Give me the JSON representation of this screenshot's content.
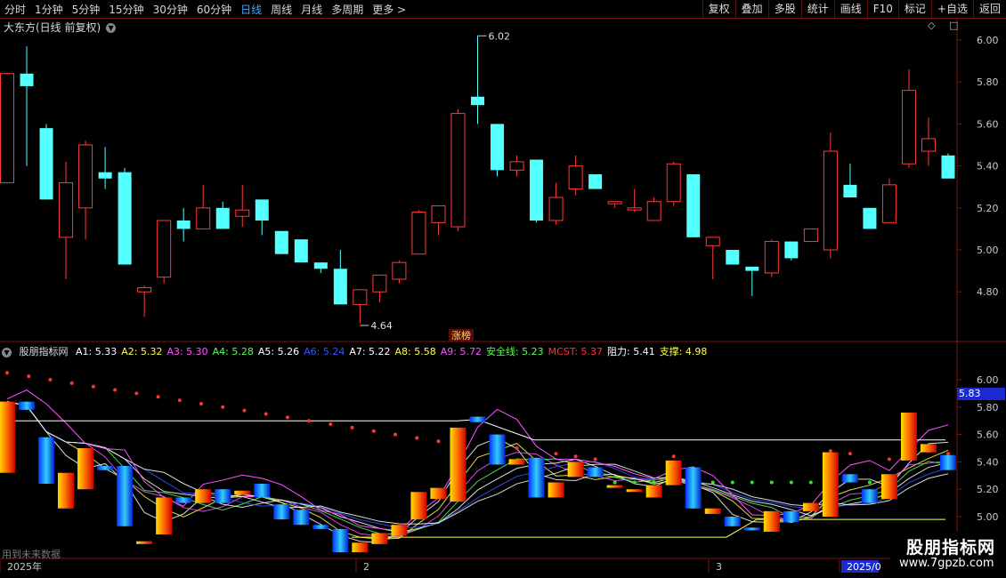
{
  "toolbar": {
    "tabs": [
      "分时",
      "1分钟",
      "5分钟",
      "15分钟",
      "30分钟",
      "60分钟",
      "日线",
      "周线",
      "月线",
      "多周期",
      "更多 >"
    ],
    "active_tab": 6,
    "right_buttons": [
      "复权",
      "叠加",
      "多股",
      "统计",
      "画线",
      "F10",
      "标记",
      "+自选",
      "返回"
    ]
  },
  "main": {
    "title": "大东方(日线 前复权)",
    "high_label": "6.02",
    "low_label": "4.64",
    "tag": "涨榜",
    "y_ticks": [
      "6.00",
      "5.80",
      "5.60",
      "5.40",
      "5.20",
      "5.00",
      "4.80"
    ],
    "icons": [
      "diamond-icon",
      "square-icon"
    ]
  },
  "indicator": {
    "name": "股朋指标网",
    "values": [
      {
        "label": "A1: 5.33",
        "color": "#ffffff"
      },
      {
        "label": "A2: 5.32",
        "color": "#ffff55"
      },
      {
        "label": "A3: 5.30",
        "color": "#ff55ff"
      },
      {
        "label": "A4: 5.28",
        "color": "#55ff55"
      },
      {
        "label": "A5: 5.26",
        "color": "#ffffff"
      },
      {
        "label": "A6: 5.24",
        "color": "#3355ff"
      },
      {
        "label": "A7: 5.22",
        "color": "#ffffff"
      },
      {
        "label": "A8: 5.58",
        "color": "#ffff55"
      },
      {
        "label": "A9: 5.72",
        "color": "#ff55ff"
      },
      {
        "label": "安全线: 5.23",
        "color": "#55ff55"
      },
      {
        "label": "MCST: 5.37",
        "color": "#ff3333"
      },
      {
        "label": "阻力: 5.41",
        "color": "#ffffff"
      },
      {
        "label": "支撑: 4.98",
        "color": "#ffff55"
      }
    ],
    "y_ticks": [
      "6.00",
      "5.80",
      "5.60",
      "5.40",
      "5.20",
      "5.00"
    ],
    "price_badge": "5.83",
    "note": "用到未来数据"
  },
  "time_axis": [
    "2025年",
    "2",
    "3",
    "2025/0"
  ],
  "watermark": {
    "line1": "股朋指标网",
    "line2": "www.7gpzb.com"
  },
  "colors": {
    "up": "#ff3b3b",
    "down": "#54ffff",
    "grid": "#7a1212",
    "ma": "#ffffff"
  },
  "chart_data": {
    "type": "candlestick",
    "ohlc": [
      [
        5.32,
        5.84,
        5.32,
        5.84
      ],
      [
        5.84,
        5.97,
        5.4,
        5.78
      ],
      [
        5.58,
        5.6,
        5.24,
        5.24
      ],
      [
        5.06,
        5.42,
        4.86,
        5.32
      ],
      [
        5.2,
        5.52,
        5.05,
        5.5
      ],
      [
        5.37,
        5.49,
        5.29,
        5.34
      ],
      [
        5.37,
        5.39,
        4.93,
        4.93
      ],
      [
        4.8,
        4.83,
        4.68,
        4.82
      ],
      [
        4.87,
        5.14,
        4.84,
        5.14
      ],
      [
        5.14,
        5.2,
        5.04,
        5.1
      ],
      [
        5.1,
        5.31,
        5.1,
        5.2
      ],
      [
        5.2,
        5.23,
        5.1,
        5.1
      ],
      [
        5.16,
        5.31,
        5.11,
        5.19
      ],
      [
        5.24,
        5.24,
        5.07,
        5.14
      ],
      [
        5.09,
        5.09,
        4.98,
        4.98
      ],
      [
        5.05,
        5.05,
        4.94,
        4.94
      ],
      [
        4.94,
        4.94,
        4.89,
        4.91
      ],
      [
        4.91,
        5.0,
        4.74,
        4.74
      ],
      [
        4.74,
        4.8,
        4.65,
        4.81
      ],
      [
        4.8,
        4.88,
        4.75,
        4.88
      ],
      [
        4.86,
        4.95,
        4.84,
        4.94
      ],
      [
        4.98,
        5.19,
        4.98,
        5.18
      ],
      [
        5.13,
        5.21,
        5.07,
        5.21
      ],
      [
        5.11,
        5.67,
        5.09,
        5.65
      ],
      [
        5.73,
        6.02,
        5.6,
        5.69
      ],
      [
        5.6,
        5.6,
        5.35,
        5.38
      ],
      [
        5.38,
        5.45,
        5.35,
        5.42
      ],
      [
        5.43,
        5.43,
        5.13,
        5.14
      ],
      [
        5.14,
        5.32,
        5.12,
        5.25
      ],
      [
        5.29,
        5.45,
        5.26,
        5.4
      ],
      [
        5.36,
        5.36,
        5.29,
        5.29
      ],
      [
        5.22,
        5.23,
        5.2,
        5.23
      ],
      [
        5.19,
        5.29,
        5.18,
        5.2
      ],
      [
        5.14,
        5.25,
        5.14,
        5.23
      ],
      [
        5.23,
        5.42,
        5.21,
        5.41
      ],
      [
        5.36,
        5.36,
        5.06,
        5.06
      ],
      [
        5.02,
        5.06,
        4.86,
        5.06
      ],
      [
        5.0,
        5.0,
        4.93,
        4.93
      ],
      [
        4.92,
        4.92,
        4.78,
        4.9
      ],
      [
        4.89,
        5.05,
        4.87,
        5.04
      ],
      [
        5.04,
        5.04,
        4.95,
        4.96
      ],
      [
        5.04,
        5.1,
        5.04,
        5.1
      ],
      [
        5.0,
        5.56,
        4.96,
        5.47
      ],
      [
        5.31,
        5.41,
        5.31,
        5.25
      ],
      [
        5.2,
        5.2,
        5.1,
        5.1
      ],
      [
        5.13,
        5.34,
        5.13,
        5.31
      ],
      [
        5.41,
        5.86,
        5.39,
        5.76
      ],
      [
        5.47,
        5.63,
        5.4,
        5.53
      ],
      [
        5.45,
        5.46,
        5.34,
        5.34
      ]
    ]
  }
}
